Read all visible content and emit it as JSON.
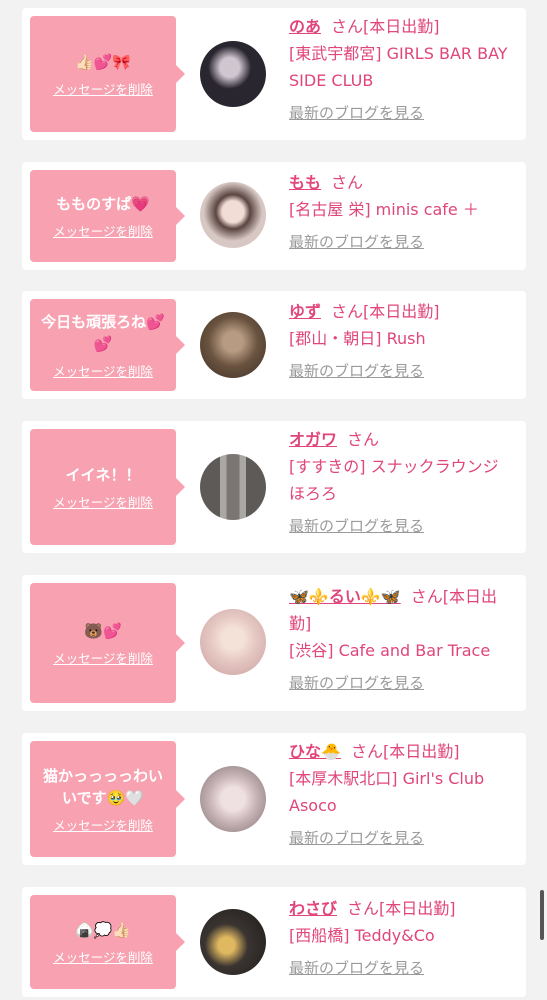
{
  "messages": [
    {
      "text": "👍🏻💕🎀",
      "delete_label": "メッセージを削除",
      "name": "のあ",
      "san": "さん",
      "status": "[本日出勤]",
      "shop": "[東武宇都宮] GIRLS BAR BAY SIDE CLUB",
      "blog_label": "最新のブログを見る",
      "avatar_color": "#2a2630"
    },
    {
      "text": "もものすぱ💗",
      "delete_label": "メッセージを削除",
      "name": "もも",
      "san": "さん",
      "status": "",
      "shop": "[名古屋 栄] minis cafe ＋",
      "blog_label": "最新のブログを見る",
      "avatar_color": "#d8c8c4"
    },
    {
      "text": "今日も頑張ろね💕\n💕",
      "delete_label": "メッセージを削除",
      "name": "ゆず",
      "san": "さん",
      "status": "[本日出勤]",
      "shop": "[郡山・朝日] Rush",
      "blog_label": "最新のブログを見る",
      "avatar_color": "#6a5340"
    },
    {
      "text": "イイネ！！",
      "delete_label": "メッセージを削除",
      "name": "オガワ",
      "san": "さん",
      "status": "",
      "shop": "[すすきの] スナックラウンジ　ほろろ",
      "blog_label": "最新のブログを見る",
      "avatar_color": "#8f8d8a"
    },
    {
      "text": "🐻💕",
      "delete_label": "メッセージを削除",
      "name": "🦋⚜️るい⚜️🦋",
      "san": "さん",
      "status": "[本日出勤]",
      "shop": "[渋谷] Cafe and Bar Trace",
      "blog_label": "最新のブログを見る",
      "avatar_color": "#e6c9c3"
    },
    {
      "text": "猫かっっっっわい\nいです🥹🤍",
      "delete_label": "メッセージを削除",
      "name": "ひな🐣",
      "san": "さん",
      "status": "[本日出勤]",
      "shop": "[本厚木駅北口] Girl's Club Asoco",
      "blog_label": "最新のブログを見る",
      "avatar_color": "#c7b4b6"
    },
    {
      "text": "🍙💭👍🏻",
      "delete_label": "メッセージを削除",
      "name": "わさび",
      "san": "さん",
      "status": "[本日出勤]",
      "shop": "[西船橋] Teddy&Co",
      "blog_label": "最新のブログを見る",
      "avatar_color": "#3a3431"
    }
  ]
}
